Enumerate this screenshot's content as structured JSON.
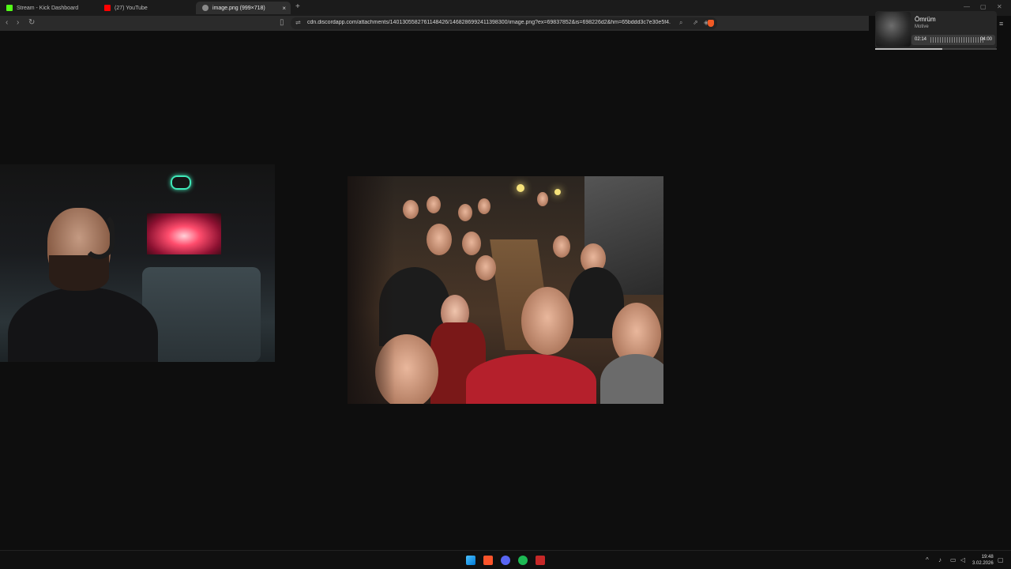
{
  "browser": {
    "tabs": [
      {
        "label": "Stream - Kick Dashboard",
        "icon": "kick-icon",
        "color": "#53fc18"
      },
      {
        "label": "(27) YouTube",
        "icon": "youtube-icon",
        "color": "#ff0000"
      },
      {
        "label": "image.png (999×718)",
        "icon": "globe-icon",
        "active": true
      }
    ],
    "url": "cdn.discordapp.com/attachments/1401305582761148426/1468286992411398300/image.png?ex=69837852&is=698226d2&hm=65bddd3c7e30e5f4...",
    "new_tab": "+",
    "close_tab": "×"
  },
  "music_widget": {
    "title": "Ömrüm",
    "artist": "Motive",
    "elapsed": "02:14",
    "total": "04:00",
    "progress_fraction": 0.55
  },
  "taskbar": {
    "icons": [
      "windows-start-icon",
      "brave-icon",
      "discord-icon",
      "spotify-icon",
      "obs-icon"
    ],
    "time": "19:48",
    "date": "3.02.2026"
  }
}
